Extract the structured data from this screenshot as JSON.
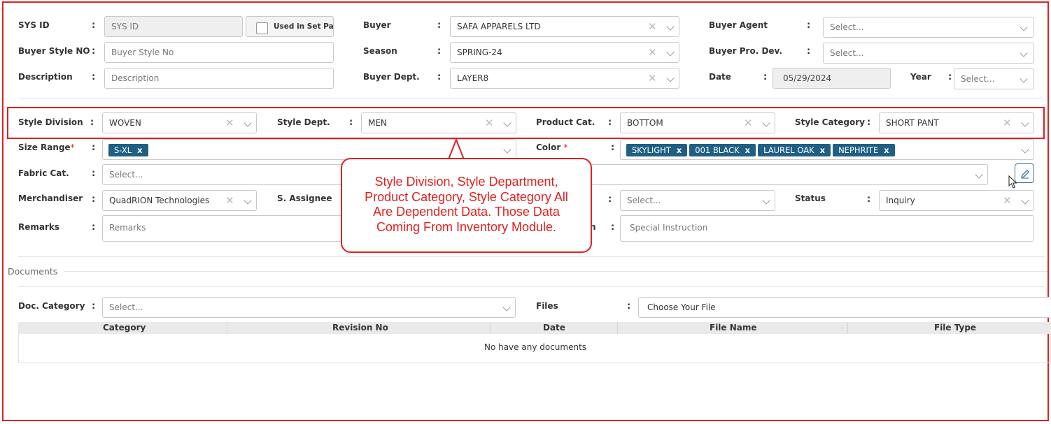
{
  "colors": {
    "accent": "#1f5f84",
    "highlight": "#e02020"
  },
  "form": {
    "sys_id": {
      "label": "SYS ID",
      "placeholder": "SYS ID"
    },
    "used_in_set_pack": {
      "label": "Used in Set Pack"
    },
    "buyer": {
      "label": "Buyer",
      "value": "SAFA APPARELS LTD"
    },
    "buyer_agent": {
      "label": "Buyer Agent",
      "placeholder": "Select..."
    },
    "buyer_style_no": {
      "label": "Buyer Style NO",
      "placeholder": "Buyer Style No"
    },
    "season": {
      "label": "Season",
      "value": "SPRING-24"
    },
    "buyer_pro_dev": {
      "label": "Buyer Pro. Dev.",
      "placeholder": "Select..."
    },
    "description": {
      "label": "Description",
      "placeholder": "Description"
    },
    "buyer_dept": {
      "label": "Buyer Dept.",
      "value": "LAYER8"
    },
    "date": {
      "label": "Date",
      "value": "05/29/2024"
    },
    "year": {
      "label": "Year",
      "placeholder": "Select..."
    },
    "style_division": {
      "label": "Style Division",
      "value": "WOVEN"
    },
    "style_dept": {
      "label": "Style Dept.",
      "value": "MEN"
    },
    "product_cat": {
      "label": "Product Cat.",
      "value": "BOTTOM"
    },
    "style_category": {
      "label": "Style Category",
      "value": "SHORT PANT"
    },
    "size_range": {
      "label": "Size Range",
      "required_mark": "*",
      "chips": [
        "S-XL"
      ]
    },
    "color": {
      "label": "Color",
      "required_mark": "*",
      "chips": [
        "SKYLIGHT",
        "001 BLACK",
        "LAUREL OAK",
        "NEPHRITE"
      ]
    },
    "fabric_cat": {
      "label": "Fabric Cat.",
      "placeholder": "Select..."
    },
    "merchandiser": {
      "label": "Merchandiser",
      "value": "QuadRION Technologies"
    },
    "s_assignee": {
      "label": "S. Assignee",
      "placeholder": "Select..."
    },
    "status": {
      "label": "Status",
      "value": "Inquiry"
    },
    "remarks": {
      "label": "Remarks",
      "placeholder": "Remarks"
    },
    "special_instruction": {
      "label_partial": "n",
      "placeholder": "Special Instruction"
    }
  },
  "callout": {
    "lines": [
      "Style Division, Style Department,",
      "Product Category, Style Category All",
      "Are Dependent Data. Those Data",
      "Coming From Inventory Module."
    ]
  },
  "documents": {
    "section_title": "Documents",
    "doc_category": {
      "label": "Doc. Category",
      "placeholder": "Select..."
    },
    "files": {
      "label": "Files",
      "button": "Choose Your File"
    },
    "table": {
      "columns": [
        "Category",
        "Revision No",
        "Date",
        "File Name",
        "File Type"
      ],
      "empty_message": "No have any documents"
    }
  },
  "icons": {
    "clear": "close-icon",
    "dropdown": "chevron-down-icon",
    "edit": "pencil-icon",
    "cursor": "mouse-pointer-icon"
  }
}
